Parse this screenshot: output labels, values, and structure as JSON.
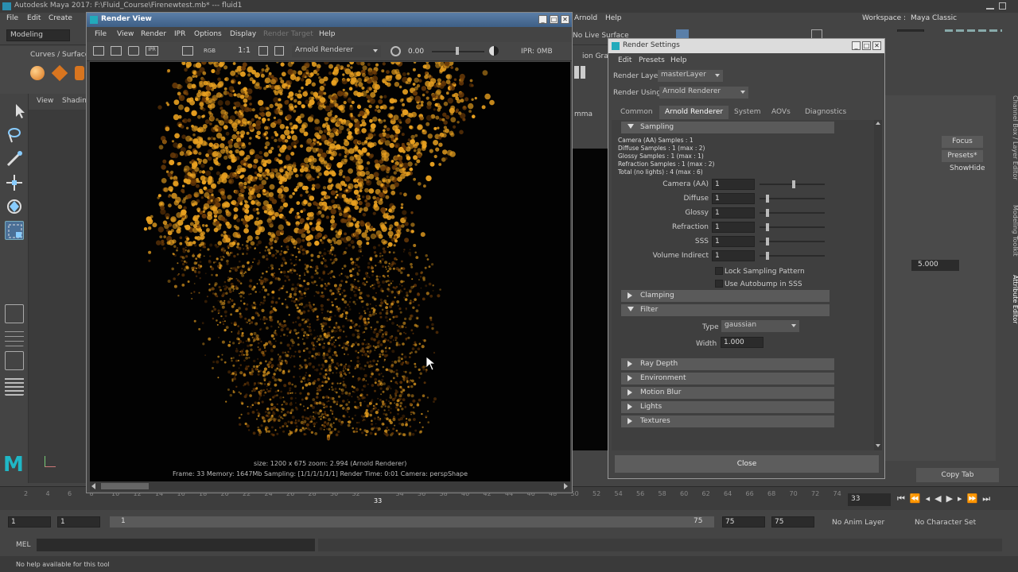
{
  "maya": {
    "title": "Autodesk Maya 2017: F:\\Fluid_Course\\Firenewtest.mb* --- fluid1",
    "menu": [
      "File",
      "Edit",
      "Create",
      "Arnold",
      "Help"
    ],
    "workspace_label": "Workspace :",
    "workspace_value": "Maya Classic",
    "mode": "Modeling",
    "no_live_surface": "No Live Surface",
    "shelf_tab": "Curves / Surfaces",
    "view_menu": [
      "View",
      "Shading"
    ],
    "graph_label": "ion Graph",
    "gamma_label": "mma",
    "right_tabs": {
      "focus": "Focus",
      "presets": "Presets*",
      "show": "Show",
      "hide": "Hide",
      "value": "5.000",
      "copy_tab": "Copy Tab",
      "channel_box": "Channel Box / Layer Editor",
      "modeling_toolkit": "Modeling Toolkit",
      "attribute_editor": "Attribute Editor"
    },
    "timeline": {
      "ticks": [
        "2",
        "4",
        "6",
        "8",
        "10",
        "12",
        "14",
        "16",
        "18",
        "20",
        "22",
        "24",
        "26",
        "28",
        "30",
        "32",
        "33",
        "34",
        "36",
        "38",
        "40",
        "42",
        "44",
        "46",
        "48",
        "50",
        "52",
        "54",
        "56",
        "58",
        "60",
        "62",
        "64",
        "66",
        "68",
        "70",
        "72",
        "74"
      ],
      "current_frame": "33"
    },
    "range": {
      "start": "1",
      "start2": "1",
      "slider_start": "1",
      "slider_end": "75",
      "end": "75",
      "end2": "75",
      "anim_layer": "No Anim Layer",
      "char_set": "No Character Set"
    },
    "mel_label": "MEL",
    "help_text": "No help available for this tool",
    "logo": "M"
  },
  "render_view": {
    "title": "Render View",
    "menu": [
      "File",
      "View",
      "Render",
      "IPR",
      "Options",
      "Display",
      "Render Target",
      "Help"
    ],
    "toolbar": {
      "rgb": "RGB",
      "ratio": "1:1",
      "renderer": "Arnold Renderer",
      "exposure": "0.00",
      "ipr_mem": "IPR: 0MB"
    },
    "caption_line1": "size: 1200 x 675  zoom: 2.994     (Arnold Renderer)",
    "caption_line2": "Frame: 33     Memory: 1647Mb     Sampling: [1/1/1/1/1/1]     Render Time: 0:01     Camera: perspShape"
  },
  "render_settings": {
    "title": "Render Settings",
    "menu": [
      "Edit",
      "Presets",
      "Help"
    ],
    "render_layer_label": "Render Layer",
    "render_layer_value": "masterLayer",
    "render_using_label": "Render Using",
    "render_using_value": "Arnold Renderer",
    "tabs": [
      "Common",
      "Arnold Renderer",
      "System",
      "AOVs",
      "Diagnostics"
    ],
    "sampling_header": "Sampling",
    "sampling_info": [
      "Camera (AA) Samples : 1",
      "Diffuse Samples : 1 (max : 2)",
      "Glossy Samples : 1 (max : 1)",
      "Refraction Samples : 1 (max : 2)",
      "Total (no lights) : 4 (max : 6)"
    ],
    "fields": [
      {
        "label": "Camera (AA)",
        "value": "1",
        "knob": 0.5
      },
      {
        "label": "Diffuse",
        "value": "1",
        "knob": 0.1
      },
      {
        "label": "Glossy",
        "value": "1",
        "knob": 0.1
      },
      {
        "label": "Refraction",
        "value": "1",
        "knob": 0.1
      },
      {
        "label": "SSS",
        "value": "1",
        "knob": 0.1
      },
      {
        "label": "Volume Indirect",
        "value": "1",
        "knob": 0.1
      }
    ],
    "lock_sampling": "Lock Sampling Pattern",
    "autobump": "Use Autobump in SSS",
    "clamping": "Clamping",
    "filter": "Filter",
    "filter_type_label": "Type",
    "filter_type_value": "gaussian",
    "filter_width_label": "Width",
    "filter_width_value": "1.000",
    "collapsed_sections": [
      "Ray Depth",
      "Environment",
      "Motion Blur",
      "Lights",
      "Textures"
    ],
    "close": "Close"
  },
  "colors": {
    "fire_bright": "#e8a020",
    "fire_dark": "#6a3a08",
    "panel": "#444444",
    "field": "#2b2b2b"
  }
}
